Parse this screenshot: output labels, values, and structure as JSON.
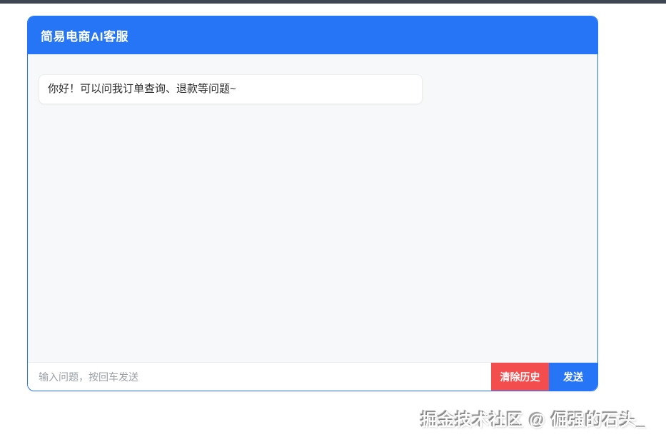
{
  "page": {
    "watermark": "掘金技术社区 @ 倔强的石头_"
  },
  "chat": {
    "title": "简易电商AI客服",
    "messages": [
      {
        "role": "assistant",
        "text": "你好！可以问我订单查询、退款等问题~"
      }
    ],
    "input": {
      "value": "",
      "placeholder": "输入问题，按回车发送"
    },
    "clear_button_label": "清除历史",
    "send_button_label": "发送"
  },
  "colors": {
    "primary_blue": "#2575f6",
    "danger_red": "#f34d4d",
    "chat_bg": "#f7f8f9",
    "top_strip": "#3f4653"
  }
}
